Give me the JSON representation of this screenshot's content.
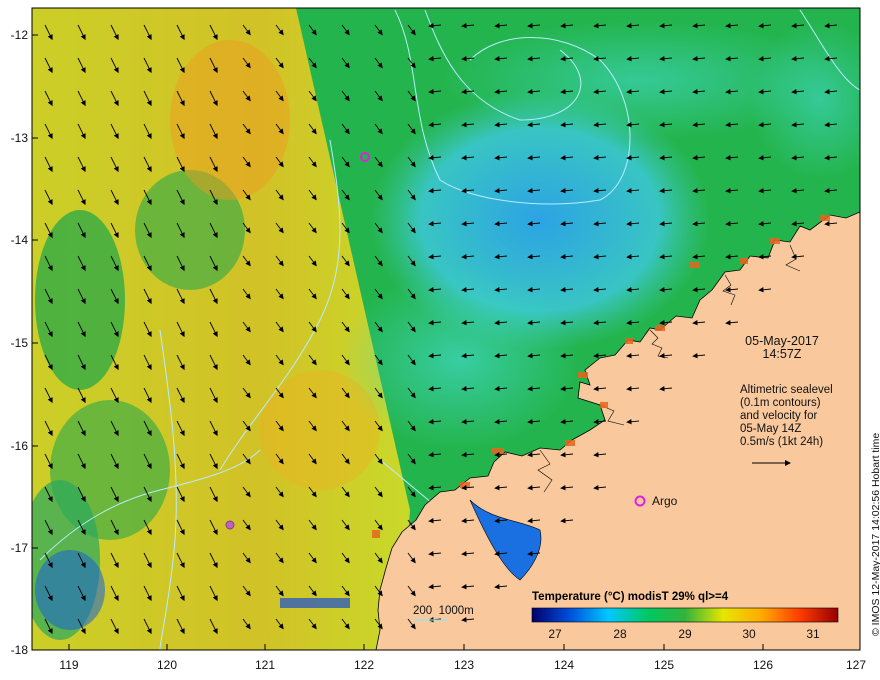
{
  "map": {
    "date_line1": "05-May-2017",
    "date_line2": "14:57Z",
    "altimetry_lines": [
      "Altimetric sealevel",
      "(0.1m contours)",
      "and velocity for",
      "05-May 14Z",
      "0.5m/s (1kt 24h)"
    ],
    "argo_label": "Argo",
    "depth_legend": "200  1000m",
    "credit": "© IMOS 12-May-2017 14:02:56 Hobart time",
    "lon_ticks": [
      "119",
      "120",
      "121",
      "122",
      "123",
      "124",
      "125",
      "126",
      "127"
    ],
    "lat_ticks": [
      "-12",
      "-13",
      "-14",
      "-15",
      "-16",
      "-17",
      "-18"
    ],
    "colorbar": {
      "title": "Temperature (°C) modisT 29% ql>=4",
      "ticks": [
        "27",
        "28",
        "29",
        "30",
        "31"
      ],
      "colors": [
        "#00006e",
        "#0050dc",
        "#00c8ff",
        "#00c864",
        "#32b43c",
        "#e6e600",
        "#ffaa00",
        "#ff3c00",
        "#960000"
      ]
    },
    "colors": {
      "land": "#f9c99d",
      "ocean_base": "#22b04a",
      "swath": "#e8cc22",
      "contour": "#aee8ff"
    }
  }
}
